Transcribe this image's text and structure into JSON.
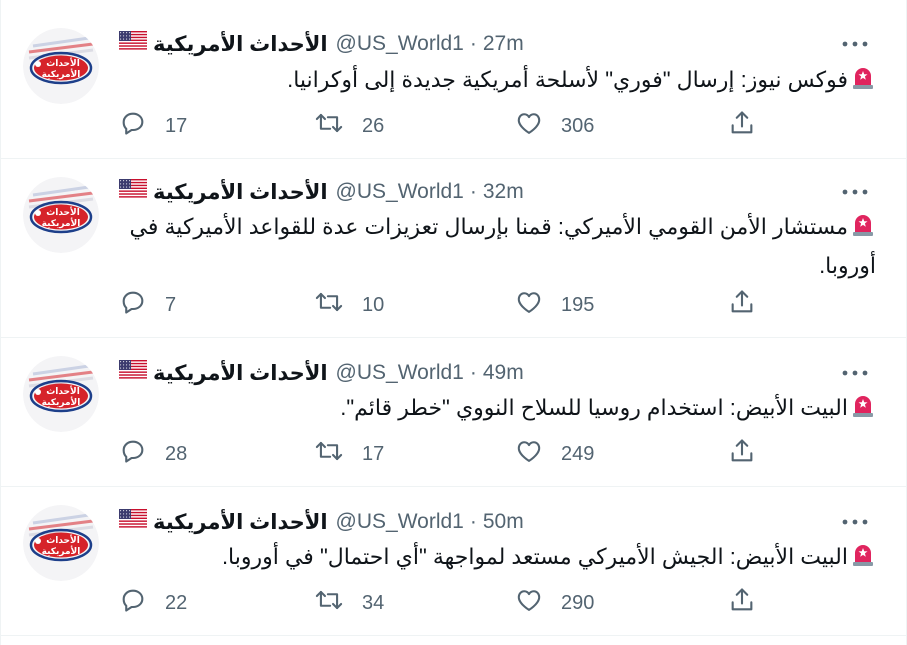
{
  "colors": {
    "text": "#0f1419",
    "secondary": "#536471",
    "divider": "#eff3f4",
    "siren": "#e0245e",
    "avatar_red": "#d6232a",
    "avatar_blue": "#1d3f8a"
  },
  "account": {
    "name": "الأحداث الأمريكية",
    "handle": "@US_World1",
    "separator": "·",
    "flag_icon": "us-flag-icon",
    "avatar_text_top": "الأحداث",
    "avatar_text_bottom": "الأمريكية"
  },
  "tweets": [
    {
      "time": "27m",
      "text": "فوكس نيوز: إرسال \"فوري\" لأسلحة أمريكية جديدة إلى أوكرانيا.",
      "replies": "17",
      "retweets": "26",
      "likes": "306"
    },
    {
      "time": "32m",
      "text": "مستشار الأمن القومي الأميركي: قمنا بإرسال تعزيزات عدة للقواعد الأميركية في أوروبا.",
      "replies": "7",
      "retweets": "10",
      "likes": "195"
    },
    {
      "time": "49m",
      "text": "البيت الأبيض: استخدام روسيا للسلاح النووي \"خطر قائم\".",
      "replies": "28",
      "retweets": "17",
      "likes": "249"
    },
    {
      "time": "50m",
      "text": "البيت الأبيض: الجيش الأميركي مستعد لمواجهة \"أي احتمال\" في أوروبا.",
      "replies": "22",
      "retweets": "34",
      "likes": "290"
    }
  ]
}
